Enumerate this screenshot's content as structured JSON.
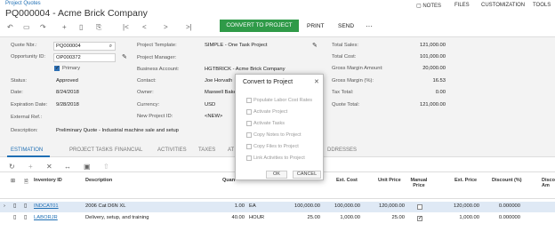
{
  "breadcrumb": "Project Quotes",
  "title": "PQ000004 - Acme Brick Company",
  "top_links": {
    "notes": "NOTES",
    "files": "FILES",
    "customization": "CUSTOMIZATION",
    "tools": "TOOLS"
  },
  "toolbar": {
    "convert": "CONVERT TO PROJECT",
    "print": "PRINT",
    "send": "SEND",
    "more": "···"
  },
  "form": {
    "quote_nbr_label": "Quote Nbr.:",
    "quote_nbr": "PQ000004",
    "opportunity_label": "Opportunity ID:",
    "opportunity": "OP000372",
    "primary_label": "Primary",
    "status_label": "Status:",
    "status": "Approved",
    "date_label": "Date:",
    "date": "8/24/2018",
    "exp_label": "Expiration Date:",
    "exp": "9/28/2018",
    "extref_label": "External Ref.:",
    "desc_label": "Description:",
    "desc": "Preliminary Quote - Industrial machine sale and setup",
    "template_label": "Project Template:",
    "template": "SIMPLE - One Task Project",
    "manager_label": "Project Manager:",
    "bizacct_label": "Business Account:",
    "bizacct": "HGTBRICK - Acme Brick Company",
    "contact_label": "Contact:",
    "contact": "Joe Horvath",
    "owner_label": "Owner:",
    "owner": "Maxwell Bake",
    "currency_label": "Currency:",
    "currency": "USD",
    "newproj_label": "New Project ID:",
    "newproj": "<NEW>",
    "total_sales_label": "Total Sales:",
    "total_sales": "121,000.00",
    "total_cost_label": "Total Cost:",
    "total_cost": "101,000.00",
    "gm_amt_label": "Gross Margin Amount:",
    "gm_amt": "20,000.00",
    "gm_pct_label": "Gross Margin (%):",
    "gm_pct": "16.53",
    "tax_label": "Tax Total:",
    "tax": "0.00",
    "quote_total_label": "Quote Total:",
    "quote_total": "121,000.00"
  },
  "tabs": [
    "ESTIMATION",
    "PROJECT TASKS",
    "FINANCIAL",
    "ACTIVITIES",
    "TAXES",
    "AT",
    "DDRESSES"
  ],
  "grid": {
    "headers": {
      "inventory": "Inventory ID",
      "desc": "Description",
      "qty": "Quan",
      "uom": "",
      "ext_cost": "Ext. Cost",
      "unit_price": "Unit Price",
      "manual_price1": "Manual",
      "manual_price2": "Price",
      "ext_price": "Ext. Price",
      "discount_pct": "Discount (%)",
      "discount_amt1": "Disco",
      "discount_amt2": "Am"
    },
    "rows": [
      {
        "inventory": "INDCAT01",
        "desc": "2006 Cat D6N XL",
        "qty": "1.00",
        "uom": "EA",
        "unit_cost": "100,000.00",
        "ext_cost": "100,000.00",
        "unit_price": "120,000.00",
        "ext_price": "120,000.00",
        "discount_pct": "0.000000",
        "manual": false
      },
      {
        "inventory": "LABORJR",
        "desc": "Delivery, setup, and training",
        "qty": "40.00",
        "uom": "HOUR",
        "unit_cost": "25.00",
        "ext_cost": "1,000.00",
        "unit_price": "25.00",
        "ext_price": "1,000.00",
        "discount_pct": "0.000000",
        "manual": true
      }
    ]
  },
  "dialog": {
    "title": "Convert to Project",
    "options": [
      "Populate Labor Cost Rates",
      "Activate Project",
      "Activate Tasks",
      "Copy Notes to Project",
      "Copy Files to Project",
      "Link Activities to Project"
    ],
    "ok": "OK",
    "cancel": "CANCEL"
  }
}
